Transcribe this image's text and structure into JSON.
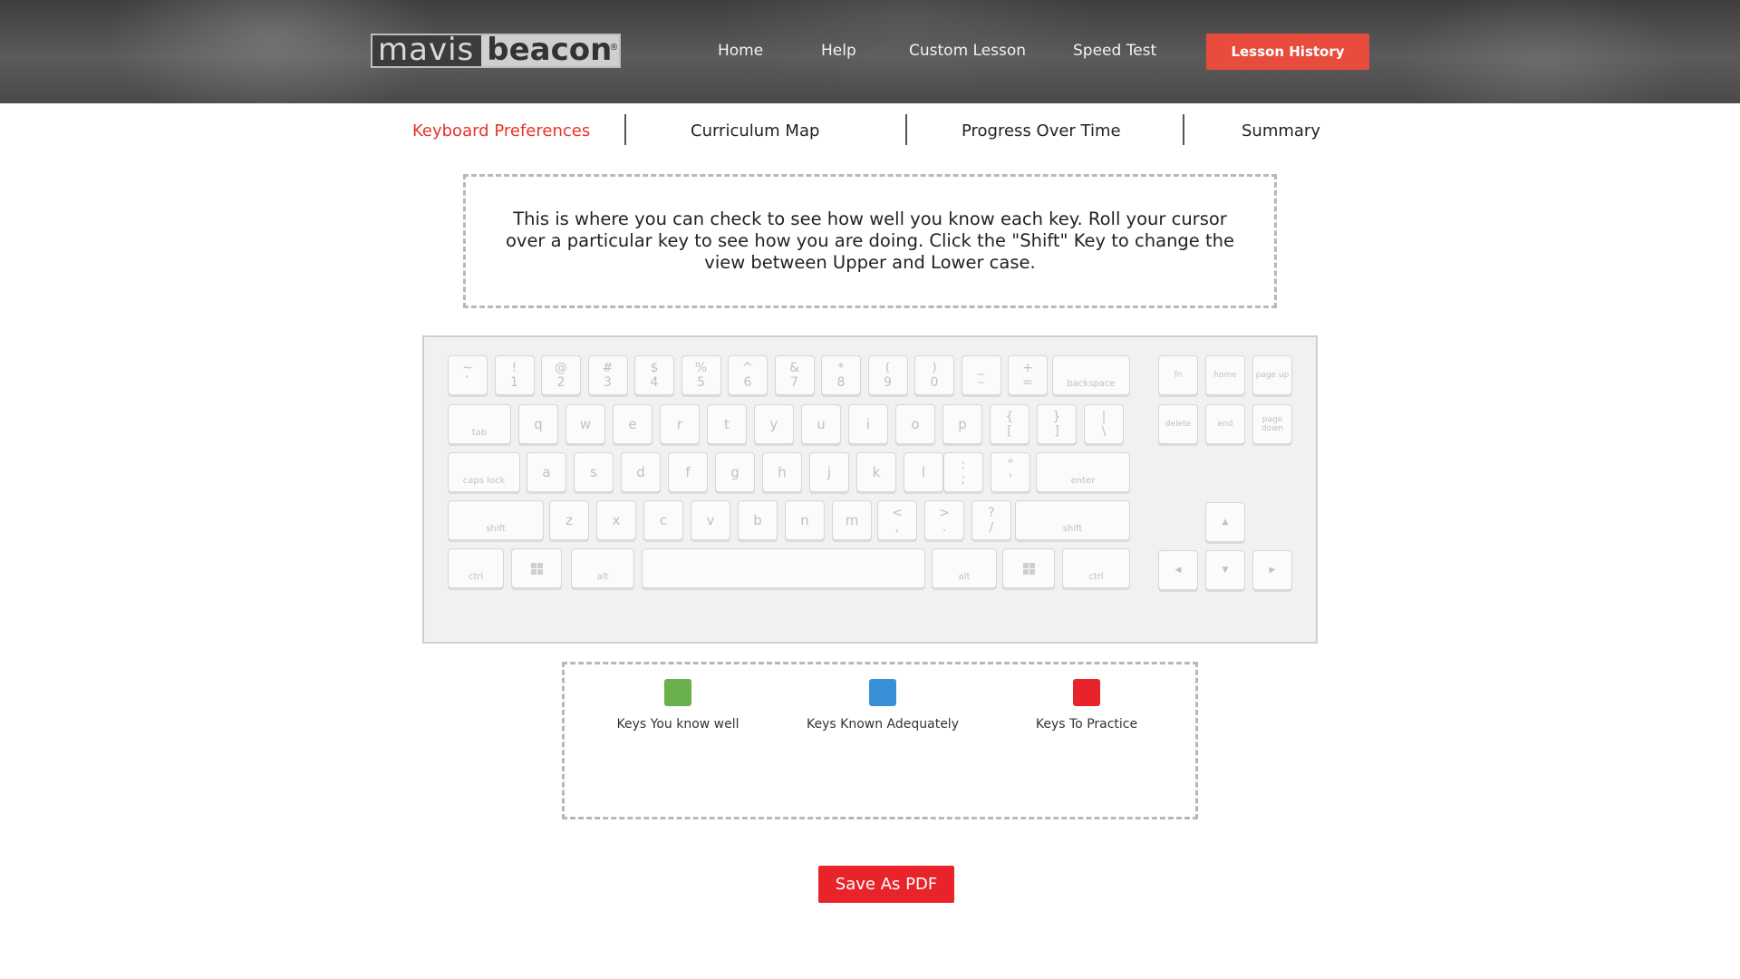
{
  "header": {
    "logo": {
      "left": "mavis",
      "right": "beacon",
      "mark": "®"
    },
    "nav": {
      "home": "Home",
      "help": "Help",
      "custom": "Custom Lesson",
      "speed": "Speed Test"
    },
    "lesson_history": "Lesson History"
  },
  "tabs": {
    "keyboard_preferences": "Keyboard Preferences",
    "curriculum_map": "Curriculum Map",
    "progress": "Progress Over Time",
    "summary": "Summary"
  },
  "info_text": "This is where you can check to see how well you know each key. Roll your cursor over a particular key to see how you are doing. Click the \"Shift\" Key to change the view between Upper and Lower case.",
  "keyboard": {
    "row1": [
      {
        "top": "~",
        "bottom": "`"
      },
      {
        "top": "!",
        "bottom": "1"
      },
      {
        "top": "@",
        "bottom": "2"
      },
      {
        "top": "#",
        "bottom": "3"
      },
      {
        "top": "$",
        "bottom": "4"
      },
      {
        "top": "%",
        "bottom": "5"
      },
      {
        "top": "^",
        "bottom": "6"
      },
      {
        "top": "&",
        "bottom": "7"
      },
      {
        "top": "*",
        "bottom": "8"
      },
      {
        "top": "(",
        "bottom": "9"
      },
      {
        "top": ")",
        "bottom": "0"
      },
      {
        "top": "_",
        "bottom": "–"
      },
      {
        "top": "+",
        "bottom": "="
      }
    ],
    "backspace": "backspace",
    "tab": "tab",
    "row2": [
      "q",
      "w",
      "e",
      "r",
      "t",
      "y",
      "u",
      "i",
      "o",
      "p"
    ],
    "row2_sym": [
      {
        "top": "{",
        "bottom": "["
      },
      {
        "top": "}",
        "bottom": "]"
      },
      {
        "top": "|",
        "bottom": "\\"
      }
    ],
    "caps": "caps lock",
    "row3": [
      "a",
      "s",
      "d",
      "f",
      "g",
      "h",
      "j",
      "k",
      "l"
    ],
    "row3_sym": [
      {
        "top": ":",
        "bottom": ";"
      },
      {
        "top": "\"",
        "bottom": "'"
      }
    ],
    "enter": "enter",
    "shift": "shift",
    "row4": [
      "z",
      "x",
      "c",
      "v",
      "b",
      "n",
      "m"
    ],
    "row4_sym": [
      {
        "top": "<",
        "bottom": ","
      },
      {
        "top": ">",
        "bottom": "."
      },
      {
        "top": "?",
        "bottom": "/"
      }
    ],
    "ctrl": "ctrl",
    "alt": "alt",
    "fn": "fn",
    "home": "home",
    "page_up": "page up",
    "delete": "delete",
    "end": "end",
    "page_down": "page down",
    "arrows": {
      "up": "▲",
      "left": "◀",
      "down": "▼",
      "right": "▶"
    }
  },
  "legend": {
    "items": [
      {
        "label": "Keys You know well",
        "color": "#6ab04c"
      },
      {
        "label": "Keys Known Adequately",
        "color": "#3a8fd9"
      },
      {
        "label": "Keys To Practice",
        "color": "#e8242a"
      }
    ]
  },
  "save_pdf": "Save As PDF"
}
